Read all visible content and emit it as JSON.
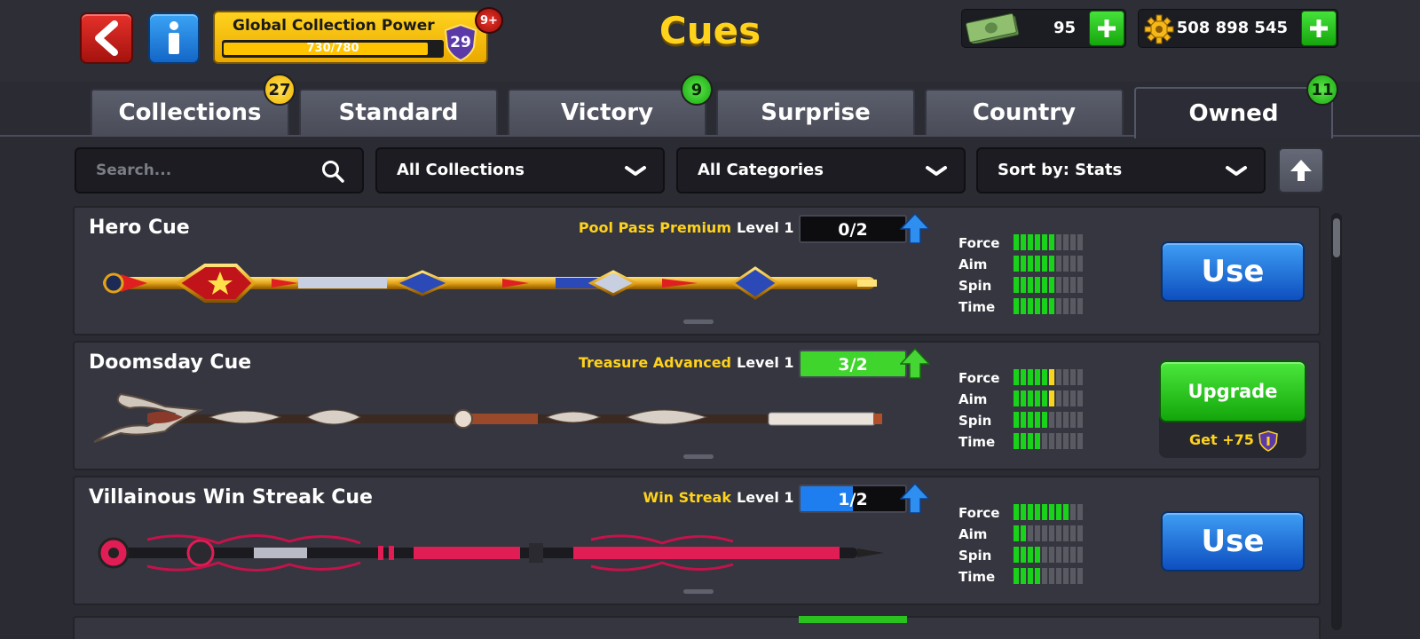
{
  "header": {
    "title": "Cues",
    "collection_power": {
      "label": "Global Collection Power",
      "progress_text": "730/780",
      "progress_fraction": 0.936,
      "level": "29",
      "badge": "9+"
    },
    "cash": {
      "value": "95",
      "icon": "cash-icon"
    },
    "coins": {
      "value": "508 898 545",
      "icon": "gear-coin-icon"
    }
  },
  "tabs": [
    {
      "label": "Collections",
      "badge": "27",
      "badge_color": "yellow"
    },
    {
      "label": "Standard"
    },
    {
      "label": "Victory",
      "badge": "9",
      "badge_color": "green"
    },
    {
      "label": "Surprise"
    },
    {
      "label": "Country"
    },
    {
      "label": "Owned",
      "badge": "11",
      "badge_color": "green",
      "active": true
    }
  ],
  "filters": {
    "search_placeholder": "Search...",
    "collections": "All Collections",
    "categories": "All Categories",
    "sort": "Sort by: Stats"
  },
  "stat_labels": [
    "Force",
    "Aim",
    "Spin",
    "Time"
  ],
  "cues": [
    {
      "name": "Hero Cue",
      "source": "Pool Pass Premium",
      "level_label": "Level 1",
      "progress": "0/2",
      "progress_fraction": 0,
      "progress_color": "#1e7ef0",
      "stats": {
        "force": 6,
        "aim": 6,
        "spin": 6,
        "time": 6
      },
      "action": "Use"
    },
    {
      "name": "Doomsday Cue",
      "source": "Treasure Advanced",
      "level_label": "Level 1",
      "progress": "3/2",
      "progress_fraction": 1,
      "progress_color": "#3fd52c",
      "stats": {
        "force": 5,
        "aim": 5,
        "spin": 5,
        "time": 4
      },
      "stats_upgrade": {
        "force": 1,
        "aim": 1,
        "spin": 0,
        "time": 0
      },
      "action": "Upgrade",
      "reward": "Get +75"
    },
    {
      "name": "Villainous Win Streak Cue",
      "source": "Win Streak",
      "level_label": "Level 1",
      "progress": "1/2",
      "progress_fraction": 0.5,
      "progress_color": "#1e7ef0",
      "stats": {
        "force": 8,
        "aim": 2,
        "spin": 4,
        "time": 4
      },
      "action": "Use"
    }
  ]
}
